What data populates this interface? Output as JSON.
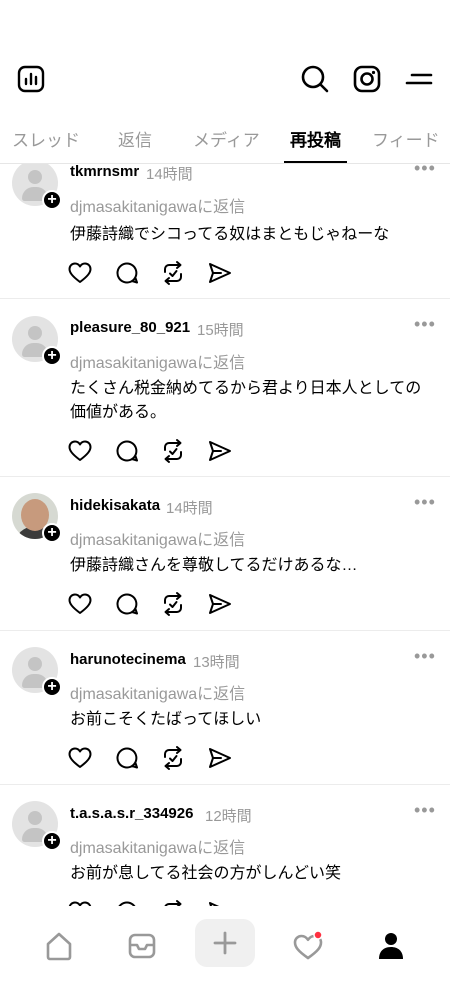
{
  "header": {
    "icons": [
      "insights-icon",
      "search-icon",
      "instagram-icon",
      "menu-icon"
    ]
  },
  "tabs": [
    {
      "label": "スレッド",
      "active": false
    },
    {
      "label": "返信",
      "active": false
    },
    {
      "label": "メディア",
      "active": false
    },
    {
      "label": "再投稿",
      "active": true
    },
    {
      "label": "フィード",
      "active": false
    }
  ],
  "posts": [
    {
      "username": "tkmrnsmr",
      "time": "14時間",
      "reply_to": "djmasakitanigawaに返信",
      "text": "伊藤詩織でシコってる奴はまともじゃねーな"
    },
    {
      "username": "pleasure_80_921",
      "time": "15時間",
      "reply_to": "djmasakitanigawaに返信",
      "text": "たくさん税金納めてるから君より日本人としての価値がある。"
    },
    {
      "username": "hidekisakata",
      "time": "14時間",
      "reply_to": "djmasakitanigawaに返信",
      "text": "伊藤詩織さんを尊敬してるだけあるな…"
    },
    {
      "username": "harunotecinema",
      "time": "13時間",
      "reply_to": "djmasakitanigawaに返信",
      "text": "お前こそくたばってほしい"
    },
    {
      "username": "t.a.s.a.s.r_334926",
      "time": "12時間",
      "reply_to": "djmasakitanigawaに返信",
      "text": "お前が息してる社会の方がしんどい笑"
    }
  ],
  "post_actions": [
    "heart-icon",
    "comment-icon",
    "repost-icon",
    "share-icon"
  ],
  "more_label": "•••",
  "follow_badge": "+",
  "bottom_nav": [
    "home-icon",
    "mail-icon",
    "create-icon",
    "activity-icon",
    "profile-icon"
  ],
  "colors": {
    "notification_dot": "#ff3040",
    "muted": "#999999"
  }
}
